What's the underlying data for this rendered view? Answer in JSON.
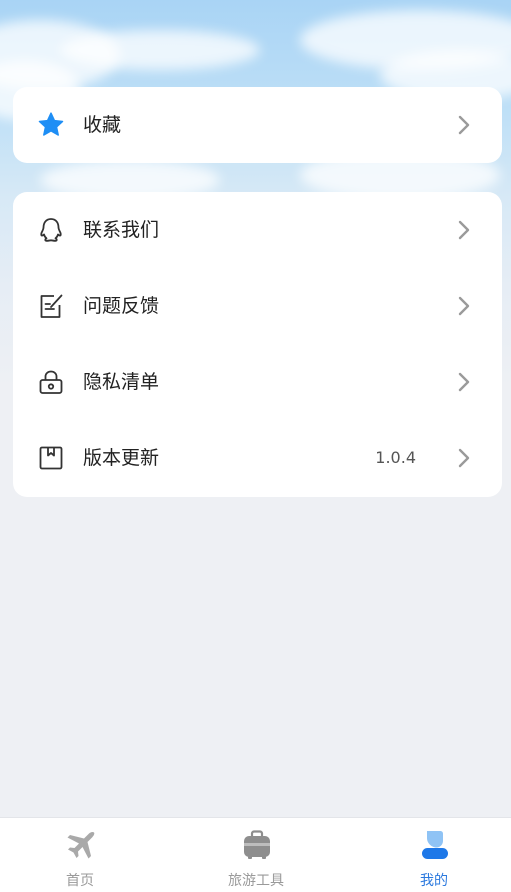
{
  "favorites": {
    "label": "收藏",
    "icon": "star-icon",
    "icon_color": "#1e8ef5"
  },
  "menu": {
    "items": [
      {
        "label": "联系我们",
        "icon": "qq-penguin-icon",
        "value": ""
      },
      {
        "label": "问题反馈",
        "icon": "feedback-edit-icon",
        "value": ""
      },
      {
        "label": "隐私清单",
        "icon": "lock-icon",
        "value": ""
      },
      {
        "label": "版本更新",
        "icon": "bookmark-icon",
        "value": "1.0.4"
      }
    ]
  },
  "tabbar": {
    "tabs": [
      {
        "label": "首页",
        "icon": "airplane-icon",
        "active": false
      },
      {
        "label": "旅游工具",
        "icon": "suitcase-icon",
        "active": false
      },
      {
        "label": "我的",
        "icon": "profile-icon",
        "active": true
      }
    ],
    "active_color": "#2b79de",
    "inactive_color": "#9a9a9a"
  }
}
